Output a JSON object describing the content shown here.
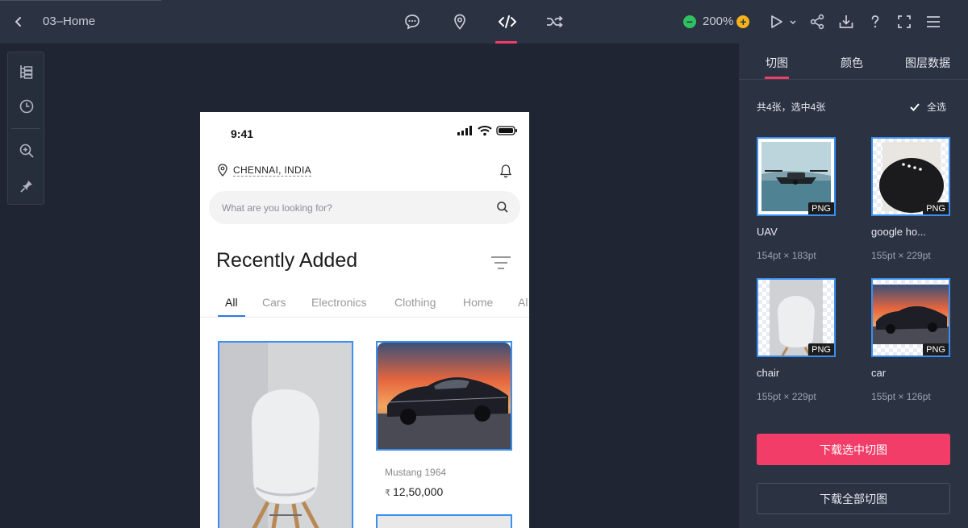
{
  "header": {
    "page_name": "03–Home",
    "zoom": "200%",
    "tabs": [
      {
        "icon": "comment-icon"
      },
      {
        "icon": "location-pin-icon"
      },
      {
        "icon": "code-icon",
        "active": true
      },
      {
        "icon": "shuffle-icon"
      }
    ],
    "right_tools": [
      "play-icon",
      "share-icon",
      "download-icon",
      "help-icon",
      "fullscreen-icon",
      "menu-icon"
    ]
  },
  "left_tools": [
    "layers-icon",
    "history-icon",
    "zoom-in-icon",
    "pin-icon"
  ],
  "phone": {
    "time": "9:41",
    "location": "CHENNAI, INDIA",
    "search_placeholder": "What are you looking for?",
    "section_title": "Recently Added",
    "tabs": [
      "All",
      "Cars",
      "Electronics",
      "Clothing",
      "Home",
      "Al"
    ],
    "active_tab": "All",
    "product": {
      "name": "Mustang 1964",
      "currency": "₹",
      "price": "12,50,000"
    }
  },
  "panel": {
    "tabs": [
      "切图",
      "颜色",
      "图层数据"
    ],
    "active_tab": "切图",
    "summary": "共4张，选中4张",
    "select_all_label": "全选",
    "select_all_checked": true,
    "slices": [
      {
        "name": "UAV",
        "size": "154pt × 183pt",
        "format": "PNG"
      },
      {
        "name": "google ho...",
        "size": "155pt × 229pt",
        "format": "PNG"
      },
      {
        "name": "chair",
        "size": "155pt × 229pt",
        "format": "PNG"
      },
      {
        "name": "car",
        "size": "155pt × 126pt",
        "format": "PNG"
      }
    ],
    "download_selected": "下载选中切图",
    "download_all": "下载全部切图"
  },
  "colors": {
    "accent": "#f23d68",
    "selection": "#3a8ff0",
    "zoom_minus": "#2fc15f",
    "zoom_plus": "#f5b21b"
  }
}
